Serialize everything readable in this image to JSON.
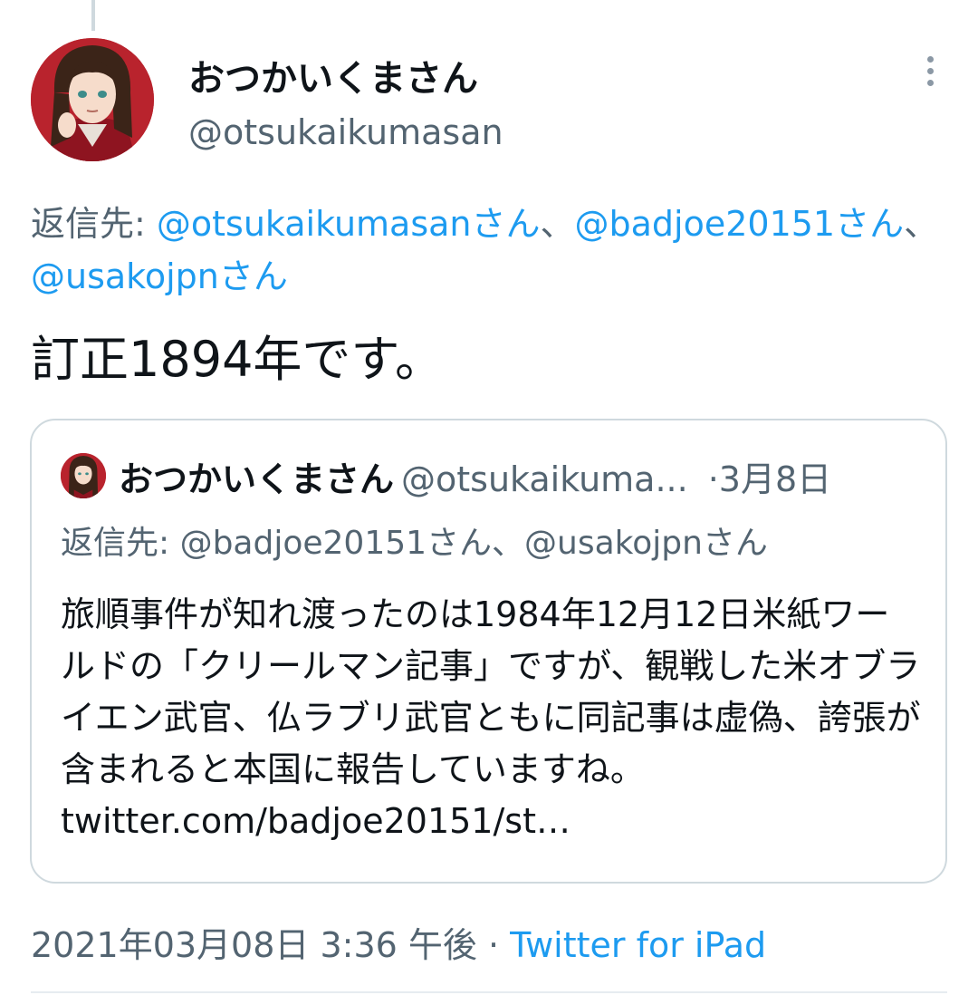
{
  "tweet": {
    "display_name": "おつかいくまさん",
    "handle": "@otsukaikumasan",
    "reply_label": "返信先: ",
    "reply_mentions": [
      "@otsukaikumasanさん",
      "@badjoe20151さん",
      "@usakojpnさん"
    ],
    "reply_separator": "、",
    "text": "訂正1894年です。",
    "timestamp": "2021年03月08日 3:36 午後",
    "meta_separator": " · ",
    "source": "Twitter for iPad"
  },
  "quote": {
    "display_name": "おつかいくまさん",
    "handle": "@otsukaikuma...",
    "dot": "·",
    "date": "3月8日",
    "reply_label": "返信先: ",
    "reply_mentions": "@badjoe20151さん、@usakojpnさん",
    "text": "旅順事件が知れ渡ったのは1984年12月12日米紙ワールドの「クリールマン記事」ですが、観戦した米オブライエン武官、仏ラブリ武官ともに同記事は虚偽、誇張が含まれると本国に報告していますね。",
    "link": "twitter.com/badjoe20151/st…"
  },
  "icons": {
    "more": "more-vertical-icon",
    "avatar": "avatar-anime-character"
  },
  "colors": {
    "link": "#1d9bf0",
    "secondary_text": "#536471",
    "primary_text": "#0f1419",
    "border": "#cfd9de"
  }
}
